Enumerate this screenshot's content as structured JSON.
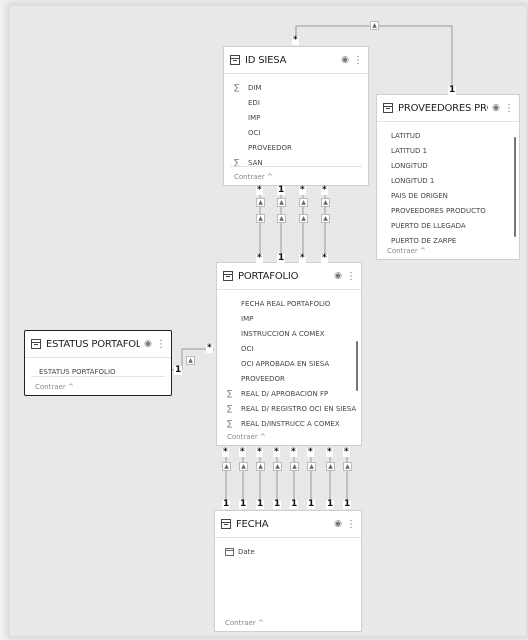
{
  "tables": {
    "id_siesa": {
      "title": "ID SIESA",
      "fields": [
        {
          "label": "DIM",
          "sum": true
        },
        {
          "label": "EDI",
          "sum": false
        },
        {
          "label": "IMP",
          "sum": false
        },
        {
          "label": "OCI",
          "sum": false
        },
        {
          "label": "PROVEEDOR",
          "sum": false
        },
        {
          "label": "SAN",
          "sum": true
        }
      ],
      "collapse_label": "Contraer ^"
    },
    "proveedores": {
      "title": "PROVEEDORES PROD...",
      "fields": [
        {
          "label": "LATITUD"
        },
        {
          "label": "LATITUD 1"
        },
        {
          "label": "LONGITUD"
        },
        {
          "label": "LONGITUD 1"
        },
        {
          "label": "PAIS DE ORIGEN"
        },
        {
          "label": "PROVEEDORES PRODUCTO"
        },
        {
          "label": "PUERTO DE LLEGADA"
        },
        {
          "label": "PUERTO DE ZARPE"
        }
      ],
      "collapse_label": "Contraer ^"
    },
    "portafolio": {
      "title": "PORTAFOLIO",
      "fields": [
        {
          "label": "FECHA REAL PORTAFOLIO",
          "sum": false
        },
        {
          "label": "IMP",
          "sum": false
        },
        {
          "label": "INSTRUCCION A COMEX",
          "sum": false
        },
        {
          "label": "OCI",
          "sum": false
        },
        {
          "label": "OCI APROBADA EN SIESA",
          "sum": false
        },
        {
          "label": "PROVEEDOR",
          "sum": false
        },
        {
          "label": "REAL D/ APROBACION FP",
          "sum": true
        },
        {
          "label": "REAL D/ REGISTRO OCI EN SIESA",
          "sum": true
        },
        {
          "label": "REAL D/INSTRUCC A COMEX",
          "sum": true
        }
      ],
      "collapse_label": "Contraer ^"
    },
    "estatus": {
      "title": "ESTATUS PORTAFOLIO",
      "fields": [
        {
          "label": "ESTATUS PORTAFOLIO"
        }
      ],
      "collapse_label": "Contraer ^"
    },
    "fecha": {
      "title": "FECHA",
      "fields": [
        {
          "label": "Date"
        }
      ],
      "collapse_label": "Contraer ^"
    }
  },
  "cardinality": {
    "many": "*",
    "one": "1"
  },
  "colors": {
    "line": "#9a9a9a",
    "border": "#cfcfcf",
    "selected_border": "#222222"
  }
}
